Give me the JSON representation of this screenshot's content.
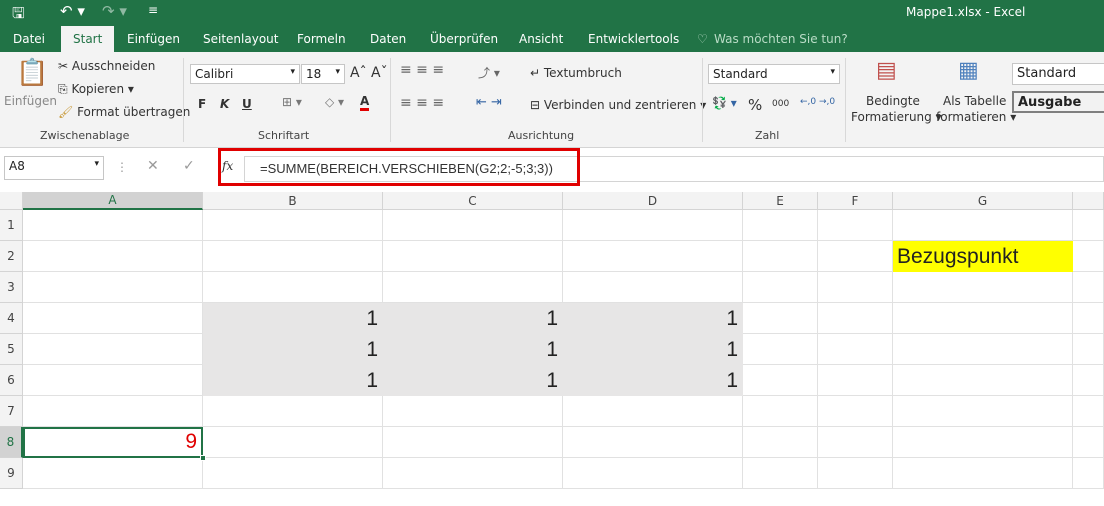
{
  "title": "Mappe1.xlsx - Excel",
  "tabs": [
    "Datei",
    "Start",
    "Einfügen",
    "Seitenlayout",
    "Formeln",
    "Daten",
    "Überprüfen",
    "Ansicht",
    "Entwicklertools"
  ],
  "tell_me": "Was möchten Sie tun?",
  "clipboard": {
    "paste": "Einfügen",
    "cut": "Ausschneiden",
    "copy": "Kopieren",
    "format_painter": "Format übertragen",
    "group": "Zwischenablage"
  },
  "font": {
    "name": "Calibri",
    "size": "18",
    "bold": "F",
    "italic": "K",
    "underline": "U",
    "group": "Schriftart",
    "font_color": "#e00000"
  },
  "alignment": {
    "wrap": "Textumbruch",
    "merge": "Verbinden und zentrieren",
    "group": "Ausrichtung"
  },
  "number": {
    "format": "Standard",
    "percent": "%",
    "thousands": "000",
    "group": "Zahl"
  },
  "styles": {
    "conditional": "Bedingte",
    "conditional2": "Formatierung",
    "table": "Als Tabelle",
    "table2": "formatieren",
    "style1": "Standard",
    "style2": "Ausgabe"
  },
  "formula_bar": {
    "name_box": "A8",
    "fx": "fx",
    "formula": "=SUMME(BEREICH.VERSCHIEBEN(G2;2;-5;3;3))"
  },
  "columns": [
    "A",
    "B",
    "C",
    "D",
    "E",
    "F",
    "G"
  ],
  "rows": [
    "1",
    "2",
    "3",
    "4",
    "5",
    "6",
    "7",
    "8",
    "9"
  ],
  "cells": {
    "B4": "1",
    "C4": "1",
    "D4": "1",
    "B5": "1",
    "C5": "1",
    "D5": "1",
    "B6": "1",
    "C6": "1",
    "D6": "1",
    "G2": "Bezugspunkt",
    "A8": "9"
  },
  "colors": {
    "accent": "#217346",
    "highlight": "#ffff00",
    "range_fill": "#e7e6e6",
    "result": "#e00000"
  }
}
